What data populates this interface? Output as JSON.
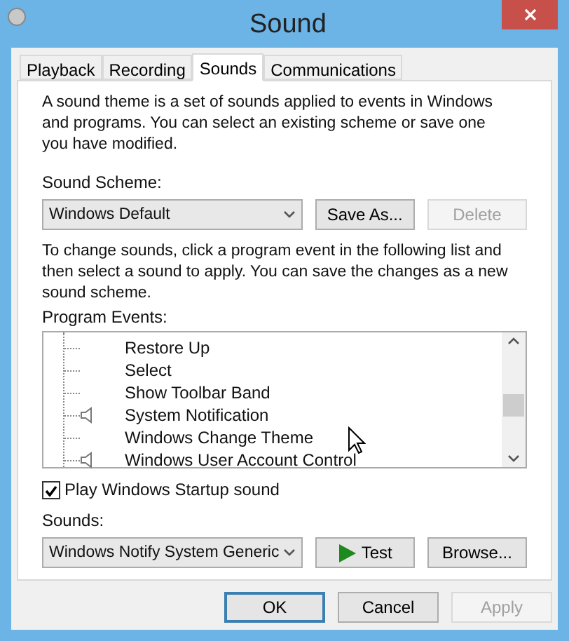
{
  "window": {
    "title": "Sound"
  },
  "tabs": [
    {
      "label": "Playback",
      "selected": false
    },
    {
      "label": "Recording",
      "selected": false
    },
    {
      "label": "Sounds",
      "selected": true
    },
    {
      "label": "Communications",
      "selected": false
    }
  ],
  "intro": "A sound theme is a set of sounds applied to events in Windows and programs.  You can select an existing scheme or save one you have modified.",
  "scheme": {
    "label": "Sound Scheme:",
    "value": "Windows Default",
    "buttons": [
      {
        "label": "Save As...",
        "disabled": false
      },
      {
        "label": "Delete",
        "disabled": true
      }
    ]
  },
  "instructions": "To change sounds, click a program event in the following list and then select a sound to apply.  You can save the changes as a new sound scheme.",
  "events": {
    "label": "Program Events:",
    "items": [
      {
        "label": "Restore Up",
        "has_sound": false
      },
      {
        "label": "Select",
        "has_sound": false
      },
      {
        "label": "Show Toolbar Band",
        "has_sound": false
      },
      {
        "label": "System Notification",
        "has_sound": true
      },
      {
        "label": "Windows Change Theme",
        "has_sound": false
      },
      {
        "label": "Windows User Account Control",
        "has_sound": true
      }
    ]
  },
  "startup": {
    "label": "Play Windows Startup sound",
    "checked": true
  },
  "sounds": {
    "label": "Sounds:",
    "value": "Windows Notify System Generic",
    "buttons": [
      {
        "label": "Test",
        "kind": "play"
      },
      {
        "label": "Browse...",
        "kind": "plain"
      }
    ]
  },
  "footer_buttons": [
    {
      "label": "OK",
      "disabled": false,
      "default": true
    },
    {
      "label": "Cancel",
      "disabled": false,
      "default": false
    },
    {
      "label": "Apply",
      "disabled": true,
      "default": false
    }
  ]
}
